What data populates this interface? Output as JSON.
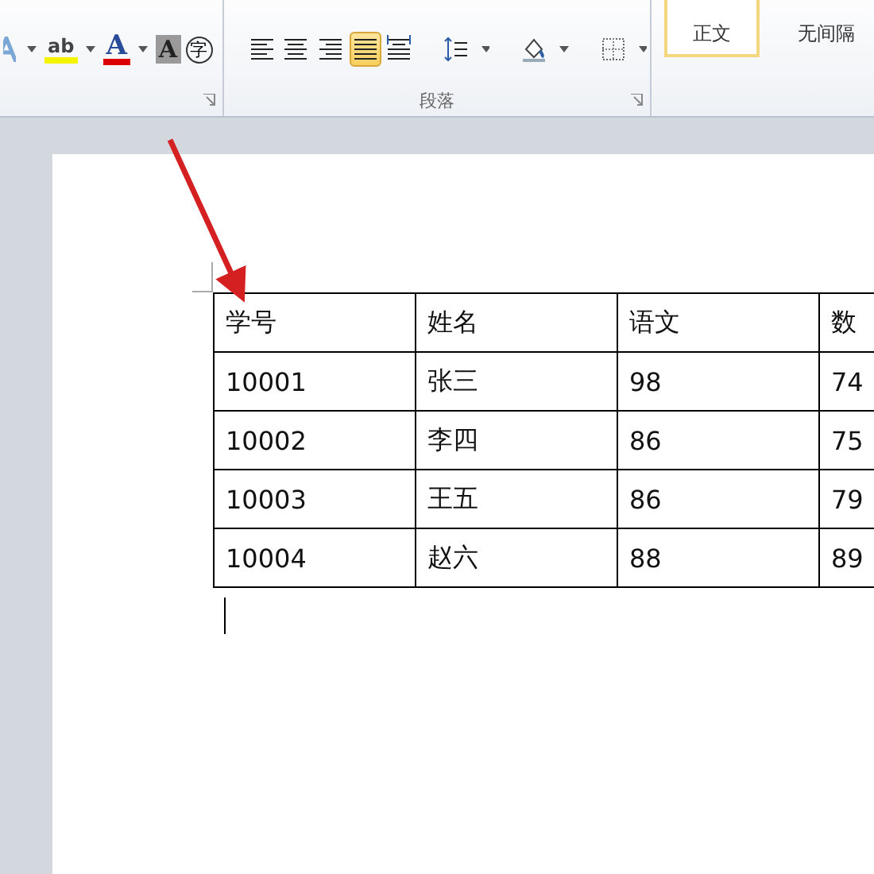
{
  "ribbon": {
    "font_tools": [
      {
        "kind": "text-effects"
      },
      {
        "kind": "highlight",
        "glyph": "ab"
      },
      {
        "kind": "font-color",
        "glyph": "A"
      },
      {
        "kind": "char-shading",
        "glyph": "A"
      },
      {
        "kind": "enclose",
        "glyph": "字"
      }
    ],
    "paragraph_tools": [
      {
        "kind": "align-left",
        "selected": false
      },
      {
        "kind": "align-center",
        "selected": false
      },
      {
        "kind": "align-right",
        "selected": false
      },
      {
        "kind": "justify",
        "selected": true
      },
      {
        "kind": "distributed",
        "selected": false
      },
      {
        "kind": "line-spacing",
        "selected": false
      },
      {
        "kind": "shading",
        "selected": false
      },
      {
        "kind": "borders",
        "selected": false
      }
    ],
    "paragraph_label": "段落",
    "styles": [
      {
        "label": "正文",
        "selected": true
      },
      {
        "label": "无间隔",
        "selected": false
      }
    ]
  },
  "table": {
    "columns": [
      "学号",
      "姓名",
      "语文",
      "数"
    ],
    "rows": [
      [
        "10001",
        "张三",
        "98",
        "74"
      ],
      [
        "10002",
        "李四",
        "86",
        "75"
      ],
      [
        "10003",
        "王五",
        "86",
        "79"
      ],
      [
        "10004",
        "赵六",
        "88",
        "89"
      ]
    ]
  }
}
